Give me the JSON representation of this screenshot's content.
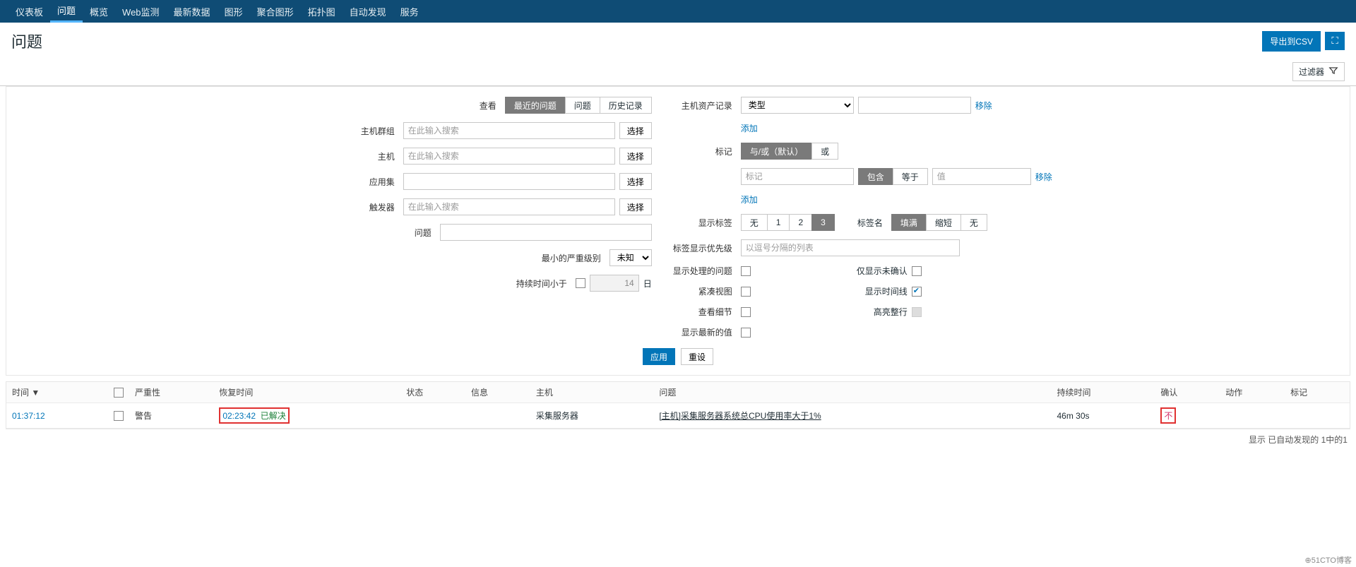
{
  "nav": {
    "items": [
      "仪表板",
      "问题",
      "概览",
      "Web监测",
      "最新数据",
      "图形",
      "聚合图形",
      "拓扑图",
      "自动发现",
      "服务"
    ],
    "active_index": 1
  },
  "header": {
    "title": "问题",
    "export_label": "导出到CSV",
    "filter_label": "过滤器"
  },
  "filters": {
    "left": {
      "view_label": "查看",
      "view_options": [
        "最近的问题",
        "问题",
        "历史记录"
      ],
      "view_active": 0,
      "hostgroup_label": "主机群组",
      "hostgroup_placeholder": "在此输入搜索",
      "hostgroup_select": "选择",
      "host_label": "主机",
      "host_placeholder": "在此输入搜索",
      "host_select": "选择",
      "application_label": "应用集",
      "application_select": "选择",
      "trigger_label": "触发器",
      "trigger_placeholder": "在此输入搜索",
      "trigger_select": "选择",
      "problem_label": "问题",
      "severity_label": "最小的严重级别",
      "severity_value": "未知",
      "age_label": "持续时间小于",
      "age_value": "14",
      "age_unit": "日"
    },
    "right": {
      "inventory_label": "主机资产记录",
      "inventory_type": "类型",
      "inventory_remove": "移除",
      "inventory_add": "添加",
      "tags_label": "标记",
      "tags_options": [
        "与/或（默认）",
        "或"
      ],
      "tags_active": 0,
      "tag_tag_placeholder": "标记",
      "tag_op_options": [
        "包含",
        "等于"
      ],
      "tag_op_active": 0,
      "tag_value_placeholder": "值",
      "tag_remove": "移除",
      "tag_add": "添加",
      "show_tags_label": "显示标签",
      "show_tags_options": [
        "无",
        "1",
        "2",
        "3"
      ],
      "show_tags_active": 3,
      "tag_name_label": "标签名",
      "tag_name_options": [
        "填满",
        "缩短",
        "无"
      ],
      "tag_name_active": 0,
      "tag_priority_label": "标签显示优先级",
      "tag_priority_placeholder": "以逗号分隔的列表",
      "show_suppressed_label": "显示处理的问题",
      "unack_only_label": "仅显示未确认",
      "compact_label": "紧凑视图",
      "timeline_label": "显示时间线",
      "details_label": "查看细节",
      "highlight_row_label": "高亮整行",
      "latest_values_label": "显示最新的值"
    },
    "apply_label": "应用",
    "reset_label": "重设"
  },
  "table": {
    "cols": [
      "时间",
      "",
      "严重性",
      "恢复时间",
      "状态",
      "信息",
      "主机",
      "问题",
      "持续时间",
      "确认",
      "动作",
      "标记"
    ],
    "sort_col": 0,
    "sort_dir": "▼",
    "rows": [
      {
        "time": "01:37:12",
        "severity": "警告",
        "recovery_time": "02:23:42",
        "status": "已解决",
        "info": "",
        "host": "采集服务器",
        "problem": "[主机]采集服务器系统总CPU使用率大于1%",
        "duration": "46m 30s",
        "ack": "不",
        "actions": "",
        "tags": ""
      }
    ]
  },
  "footer": {
    "summary": "显示 已自动发现的 1中的1"
  },
  "watermark": "⊕51CTO博客"
}
